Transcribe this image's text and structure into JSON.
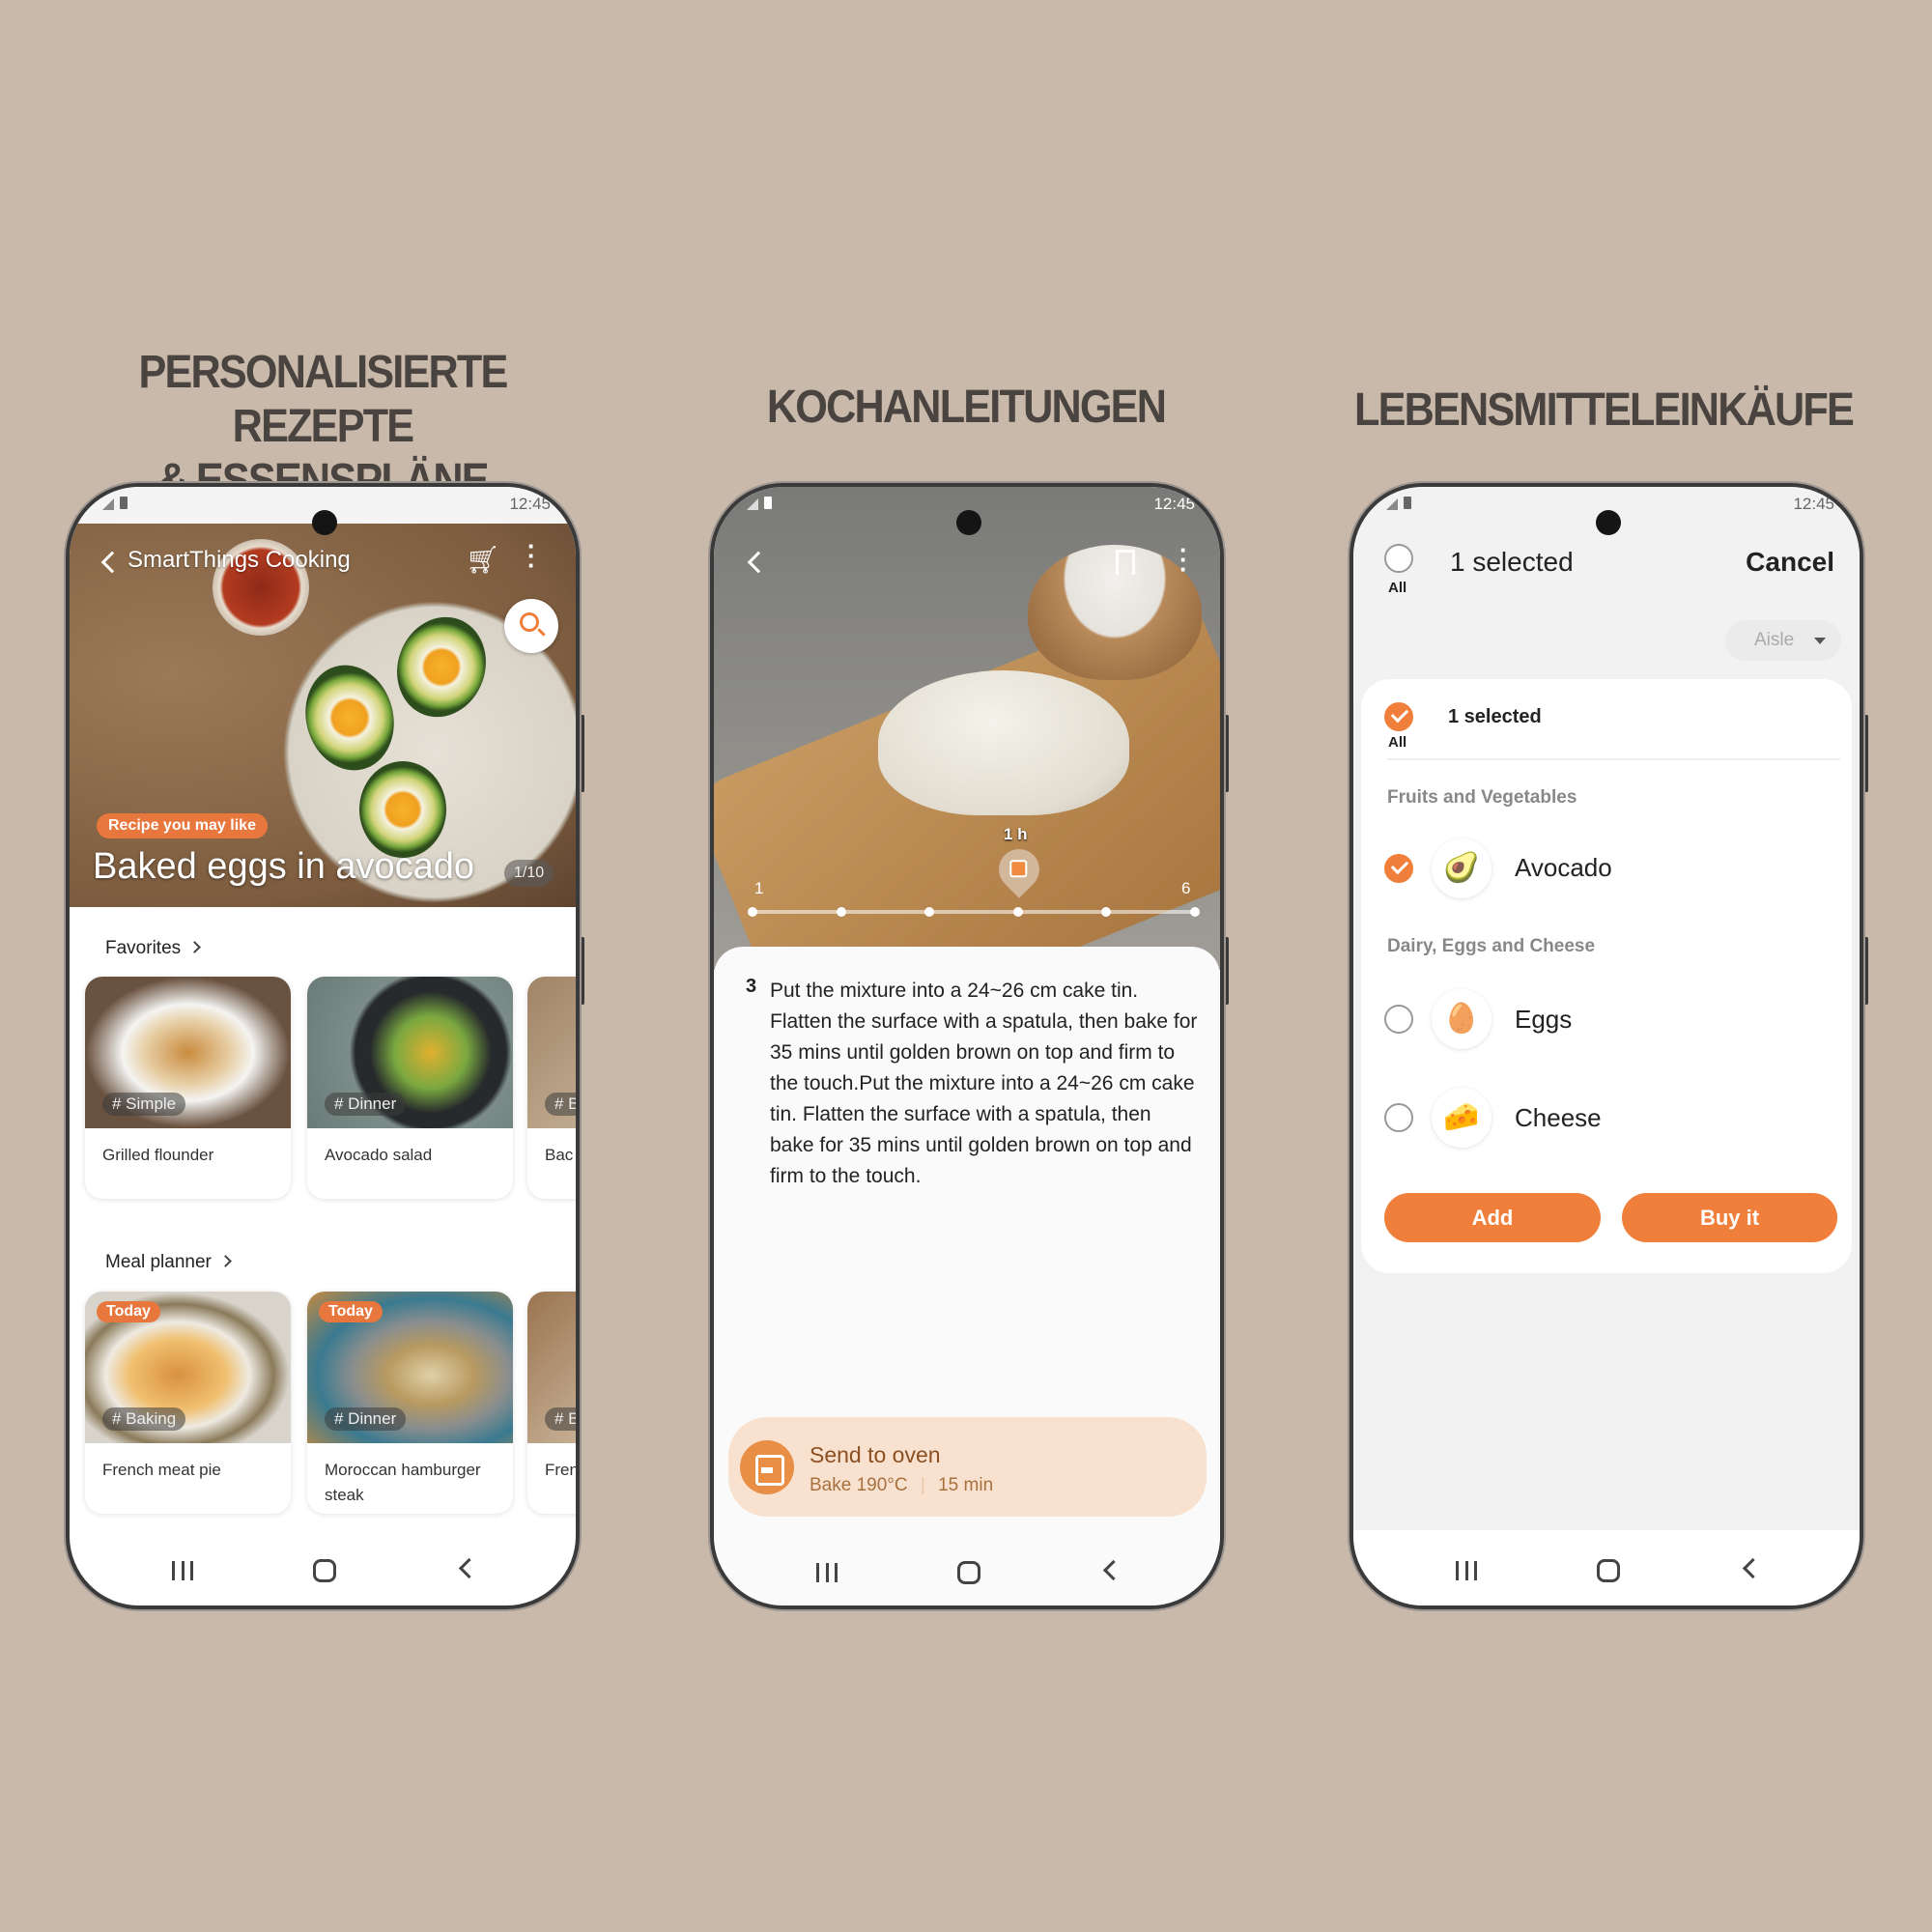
{
  "headings": {
    "recipes_line1": "PERSONALISIERTE REZEPTE",
    "recipes_line2": "& ESSENSPLÄNE",
    "cooking": "KOCHANLEITUNGEN",
    "shopping": "LEBENSMITTELEINKÄUFE"
  },
  "status": {
    "time": "12:45"
  },
  "recipes_screen": {
    "app_title": "SmartThings Cooking",
    "hero_badge": "Recipe you may like",
    "hero_title": "Baked eggs in avocado",
    "hero_counter": "1/10",
    "favorites": {
      "label": "Favorites",
      "cards": [
        {
          "tag": "# Simple",
          "name": "Grilled flounder"
        },
        {
          "tag": "# Dinner",
          "name": "Avocado salad"
        },
        {
          "tag": "# B",
          "name": "Bac"
        }
      ]
    },
    "meal_planner": {
      "label": "Meal planner",
      "cards": [
        {
          "badge": "Today",
          "tag": "# Baking",
          "name": "French meat pie"
        },
        {
          "badge": "Today",
          "tag": "# Dinner",
          "name": "Moroccan hamburger steak"
        },
        {
          "tag": "# B",
          "name": "Fren"
        }
      ]
    }
  },
  "cooking_screen": {
    "timer_label": "1 h",
    "slider": {
      "min_label": "1",
      "max_label": "6",
      "steps": 6
    },
    "step_number": "3",
    "step_text": "Put the mixture into a 24~26 cm cake tin. Flatten the surface with a spatula, then bake for 35 mins until golden brown on top and firm to the touch.Put the mixture into a 24~26 cm cake tin. Flatten the surface with a spatula, then bake for 35 mins until golden brown on top and firm to the touch.",
    "oven": {
      "title": "Send to oven",
      "mode": "Bake 190°C",
      "time": "15 min"
    }
  },
  "shopping_screen": {
    "select_all_label": "All",
    "selected_text": "1 selected",
    "cancel": "Cancel",
    "sort": "Aisle",
    "list_all_label": "All",
    "list_selected_text": "1 selected",
    "categories": [
      {
        "name": "Fruits and Vegetables",
        "items": [
          {
            "name": "Avocado",
            "checked": true,
            "icon": "avocado"
          }
        ]
      },
      {
        "name": "Dairy, Eggs and Cheese",
        "items": [
          {
            "name": "Eggs",
            "checked": false,
            "icon": "eggs"
          },
          {
            "name": "Cheese",
            "checked": false,
            "icon": "cheese"
          }
        ]
      }
    ],
    "add_button": "Add",
    "buy_button": "Buy it"
  },
  "colors": {
    "accent": "#ef7f3a",
    "background": "#c8b9ab",
    "heading": "#4a4440",
    "oven_bar": "#f8e2cf"
  }
}
